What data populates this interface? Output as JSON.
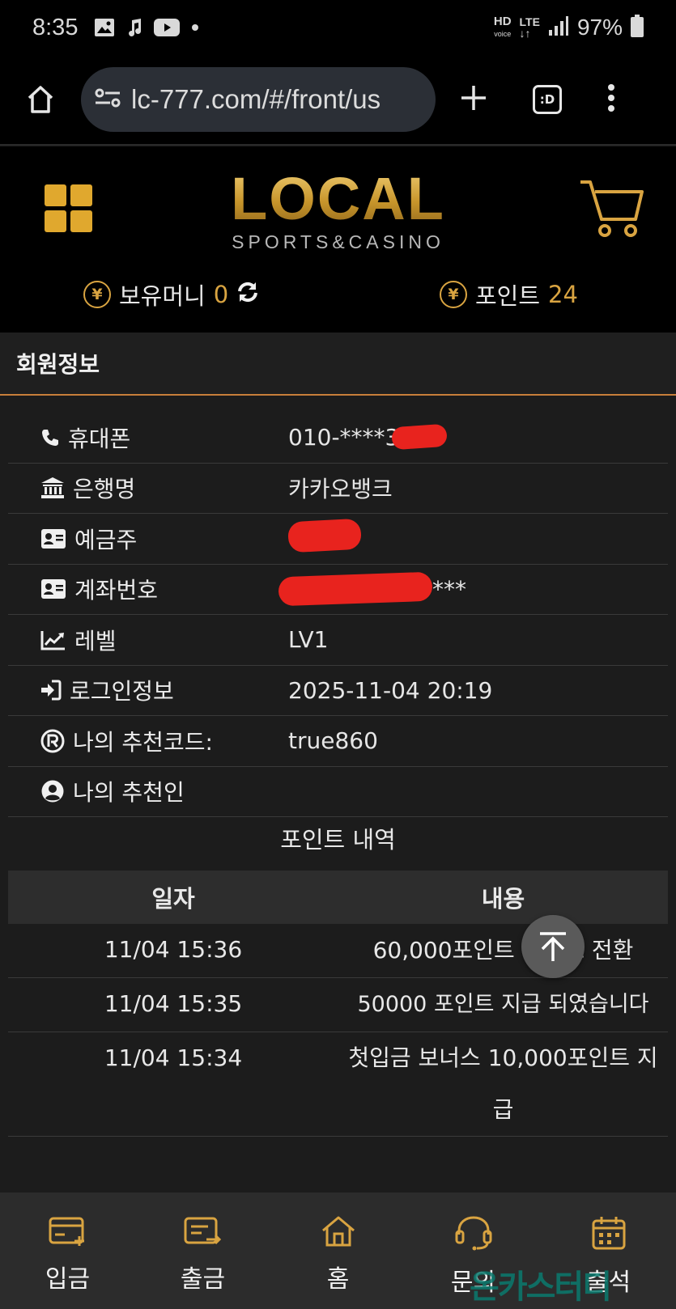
{
  "status_bar": {
    "time": "8:35",
    "battery": "97%",
    "network": "LTE",
    "hd": "HD"
  },
  "browser": {
    "url": "lc-777.com/#/front/us",
    "tab_icon_label": ":D"
  },
  "header": {
    "logo_main": "LOCAL",
    "logo_sub": "SPORTS&CASINO",
    "money_label": "보유머니",
    "money_value": "0",
    "point_label": "포인트",
    "point_value": "24"
  },
  "member": {
    "title": "회원정보",
    "rows": [
      {
        "label": "휴대폰",
        "value": "010-****33",
        "icon": "phone-icon"
      },
      {
        "label": "은행명",
        "value": "카카오뱅크",
        "icon": "bank-icon"
      },
      {
        "label": "예금주",
        "value": "",
        "icon": "id-card-icon"
      },
      {
        "label": "계좌번호",
        "value": "***",
        "icon": "id-card-icon"
      },
      {
        "label": "레벨",
        "value": "LV1",
        "icon": "chart-line-icon"
      },
      {
        "label": "로그인정보",
        "value": "2025-11-04 20:19",
        "icon": "sign-in-icon"
      },
      {
        "label": "나의 추천코드:",
        "value": "true860",
        "icon": "registered-icon"
      },
      {
        "label": "나의 추천인",
        "value": "",
        "icon": "user-circle-icon"
      }
    ]
  },
  "points_history": {
    "title": "포인트 내역",
    "col_date": "일자",
    "col_content": "내용",
    "rows": [
      {
        "date": "11/04 15:36",
        "content": "60,000포인트 머니로 전환"
      },
      {
        "date": "11/04 15:35",
        "content": "50000 포인트 지급 되였습니다"
      },
      {
        "date": "11/04 15:34",
        "content": "첫입금 보너스 10,000포인트 지급"
      }
    ]
  },
  "bottom_nav": {
    "items": [
      {
        "label": "입금",
        "icon": "deposit-card-icon"
      },
      {
        "label": "출금",
        "icon": "withdraw-card-icon"
      },
      {
        "label": "홈",
        "icon": "home-icon"
      },
      {
        "label": "문의",
        "icon": "headset-icon"
      },
      {
        "label": "출석",
        "icon": "calendar-icon"
      }
    ]
  },
  "watermark": "온카스터디",
  "colors": {
    "accent_gold": "#d9a441",
    "header_bg": "#000000",
    "page_bg": "#1c1c1c",
    "divider_orange": "#c77f3a"
  }
}
